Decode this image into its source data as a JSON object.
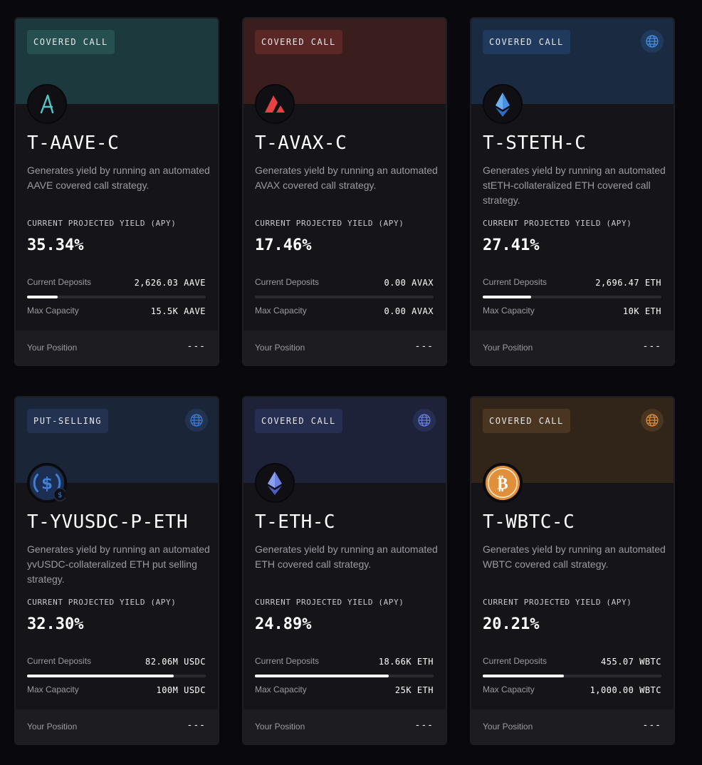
{
  "cards": [
    {
      "tag": "COVERED CALL",
      "title": "T-AAVE-C",
      "description": "Generates yield by running an automated AAVE covered call strategy.",
      "yield_label": "CURRENT PROJECTED YIELD (APY)",
      "yield": "35.34%",
      "deposits_label": "Current Deposits",
      "deposits": "2,626.03 AAVE",
      "capacity_label": "Max Capacity",
      "capacity": "15.5K AAVE",
      "deposit_fraction": 0.17,
      "position_label": "Your Position",
      "position": "---",
      "icon": "aave-logo-icon",
      "has_globe": false,
      "colors": {
        "header": "#1c3a3e",
        "tag_bg": "#26504f",
        "accent": "#4fc7c6"
      }
    },
    {
      "tag": "COVERED CALL",
      "title": "T-AVAX-C",
      "description": "Generates yield by running an automated AVAX covered call strategy.",
      "yield_label": "CURRENT PROJECTED YIELD (APY)",
      "yield": "17.46%",
      "deposits_label": "Current Deposits",
      "deposits": "0.00 AVAX",
      "capacity_label": "Max Capacity",
      "capacity": "0.00 AVAX",
      "deposit_fraction": 0,
      "position_label": "Your Position",
      "position": "---",
      "icon": "avax-logo-icon",
      "has_globe": false,
      "colors": {
        "header": "#3a1e1e",
        "tag_bg": "#5a2626",
        "accent": "#e84142"
      }
    },
    {
      "tag": "COVERED CALL",
      "title": "T-STETH-C",
      "description": "Generates yield by running an automated stETH-collateralized ETH covered call strategy.",
      "yield_label": "CURRENT PROJECTED YIELD (APY)",
      "yield": "27.41%",
      "deposits_label": "Current Deposits",
      "deposits": "2,696.47 ETH",
      "capacity_label": "Max Capacity",
      "capacity": "10K ETH",
      "deposit_fraction": 0.27,
      "position_label": "Your Position",
      "position": "---",
      "icon": "steth-logo-icon",
      "has_globe": true,
      "colors": {
        "header": "#1a2a40",
        "tag_bg": "#203a5e",
        "accent": "#4a90e2"
      }
    },
    {
      "tag": "PUT-SELLING",
      "title": "T-YVUSDC-P-ETH",
      "description": "Generates yield by running an automated yvUSDC-collateralized ETH put selling strategy.",
      "yield_label": "CURRENT PROJECTED YIELD (APY)",
      "yield": "32.30%",
      "deposits_label": "Current Deposits",
      "deposits": "82.06M USDC",
      "capacity_label": "Max Capacity",
      "capacity": "100M USDC",
      "deposit_fraction": 0.82,
      "position_label": "Your Position",
      "position": "---",
      "icon": "usdc-logo-icon",
      "has_globe": true,
      "colors": {
        "header": "#1b2538",
        "tag_bg": "#223250",
        "accent": "#3f7fd8"
      }
    },
    {
      "tag": "COVERED CALL",
      "title": "T-ETH-C",
      "description": "Generates yield by running an automated ETH covered call strategy.",
      "yield_label": "CURRENT PROJECTED YIELD (APY)",
      "yield": "24.89%",
      "deposits_label": "Current Deposits",
      "deposits": "18.66K ETH",
      "capacity_label": "Max Capacity",
      "capacity": "25K ETH",
      "deposit_fraction": 0.75,
      "position_label": "Your Position",
      "position": "---",
      "icon": "eth-logo-icon",
      "has_globe": true,
      "colors": {
        "header": "#1d2238",
        "tag_bg": "#262f52",
        "accent": "#6a7fe0"
      }
    },
    {
      "tag": "COVERED CALL",
      "title": "T-WBTC-C",
      "description": "Generates yield by running an automated WBTC covered call strategy.",
      "yield_label": "CURRENT PROJECTED YIELD (APY)",
      "yield": "20.21%",
      "deposits_label": "Current Deposits",
      "deposits": "455.07 WBTC",
      "capacity_label": "Max Capacity",
      "capacity": "1,000.00 WBTC",
      "deposit_fraction": 0.455,
      "position_label": "Your Position",
      "position": "---",
      "icon": "btc-logo-icon",
      "has_globe": true,
      "colors": {
        "header": "#302518",
        "tag_bg": "#4a3520",
        "accent": "#e0903a"
      }
    }
  ]
}
